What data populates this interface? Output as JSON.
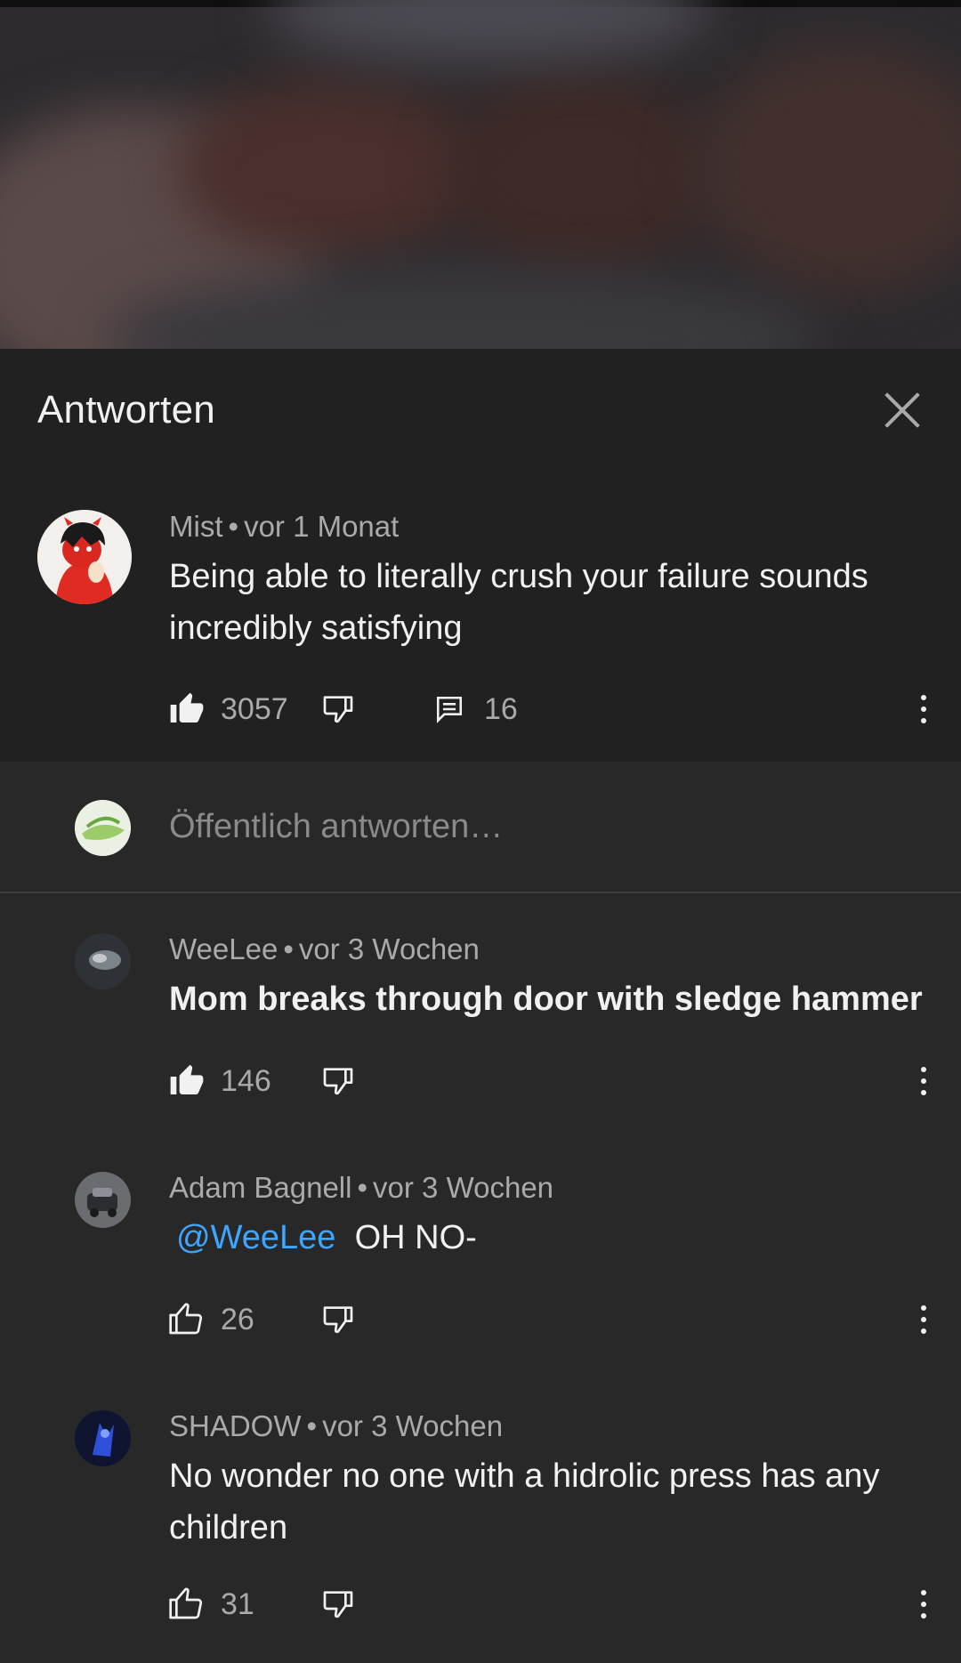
{
  "panel": {
    "title": "Antworten"
  },
  "parent_comment": {
    "author": "Mist",
    "time": "vor 1 Monat",
    "text_line1": "Being able to literally crush your failure sounds",
    "text_line2": "incredibly satisfying",
    "likes": "3057",
    "replies": "16"
  },
  "reply_input": {
    "placeholder": "Öffentlich antworten…"
  },
  "replies": [
    {
      "author": "WeeLee",
      "time": "vor 3 Wochen",
      "text": "Mom breaks through door with sledge hammer",
      "likes": "146"
    },
    {
      "author": "Adam Bagnell",
      "time": "vor 3 Wochen",
      "mention": "@WeeLee",
      "text": "OH NO-",
      "likes": "26"
    },
    {
      "author": "SHADOW",
      "time": "vor 3 Wochen",
      "text_line1": "No wonder no one with a hidrolic press has any",
      "text_line2": "children",
      "likes": "31"
    }
  ],
  "separator": "•",
  "icons": [
    "close-icon",
    "thumbs-up-icon",
    "thumbs-down-icon",
    "comment-icon",
    "more-vert-icon"
  ],
  "colors": {
    "panel_bg": "#212121",
    "page_bg": "#282828",
    "mention": "#3ea6ff",
    "meta_text": "#aaaaaa"
  }
}
